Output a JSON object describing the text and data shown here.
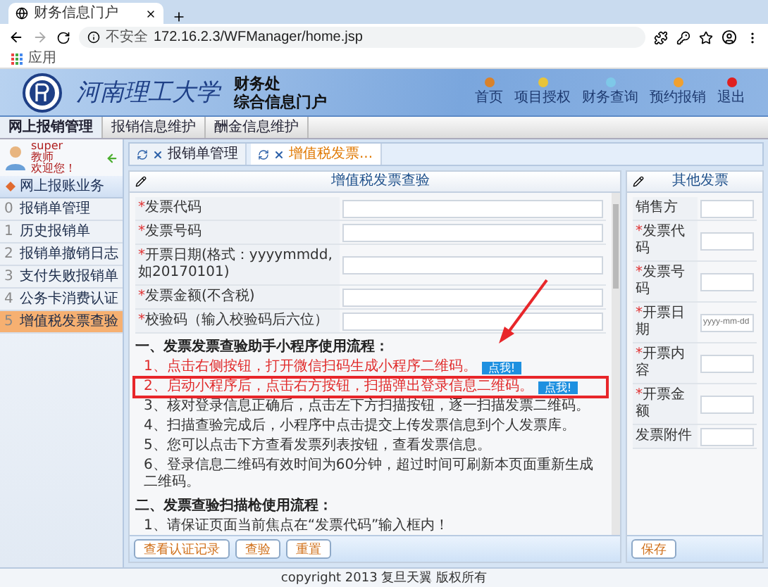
{
  "browser": {
    "tab_title": "财务信息门户",
    "security": "不安全",
    "url": "172.16.2.3/WFManager/home.jsp",
    "bookmarks": [
      "应用"
    ]
  },
  "header": {
    "school": "河南理工大学",
    "dept": "财务处",
    "portal": "综合信息门户",
    "links": [
      {
        "label": "首页",
        "color": "#d9822b"
      },
      {
        "label": "项目授权",
        "color": "#e8c43a"
      },
      {
        "label": "财务查询",
        "color": "#7ec8e8"
      },
      {
        "label": "预约报销",
        "color": "#f0a030"
      },
      {
        "label": "退出",
        "color": "#e02020"
      }
    ]
  },
  "menu": [
    {
      "label": "网上报销管理",
      "selected": true
    },
    {
      "label": "报销信息维护",
      "selected": false
    },
    {
      "label": "酬金信息维护",
      "selected": false
    }
  ],
  "user": {
    "name": "super",
    "role": "教师",
    "greeting": "欢迎您！"
  },
  "sidebar": {
    "section": "网上报账业务",
    "items": [
      {
        "index": "0",
        "label": "报销单管理",
        "selected": false
      },
      {
        "index": "1",
        "label": "历史报销单",
        "selected": false
      },
      {
        "index": "2",
        "label": "报销单撤销日志",
        "selected": false
      },
      {
        "index": "3",
        "label": "支付失败报销单",
        "selected": false
      },
      {
        "index": "4",
        "label": "公务卡消费认证",
        "selected": false
      },
      {
        "index": "5",
        "label": "增值税发票查验",
        "selected": true
      }
    ]
  },
  "tabs": [
    {
      "label": "报销单管理",
      "selected": false
    },
    {
      "label": "增值税发票...",
      "selected": true
    }
  ],
  "vat_panel": {
    "title": "增值税发票查验",
    "fields": [
      {
        "mark": "*",
        "label": "发票代码"
      },
      {
        "mark": "*",
        "label": "发票号码"
      },
      {
        "mark": "*",
        "label": "开票日期(格式：yyyymmdd,如20170101)"
      },
      {
        "mark": "*",
        "label": "发票金额(不含税)"
      },
      {
        "mark": "*",
        "label": "校验码（输入校验码后六位）"
      }
    ],
    "sections": [
      {
        "heading": "一、发票发票查验助手小程序使用流程：",
        "steps": [
          {
            "text": "1、点击右侧按钮，打开微信扫码生成小程序二维码。",
            "emphasis": true,
            "highlighted": false,
            "button": "点我!"
          },
          {
            "text": "2、启动小程序后，点击右方按钮，扫描弹出登录信息二维码。",
            "emphasis": true,
            "highlighted": true,
            "button": "点我!"
          },
          {
            "text": "3、核对登录信息正确后，点击左下方扫描按钮，逐一扫描发票二维码。",
            "emphasis": false,
            "highlighted": false
          },
          {
            "text": "4、扫描查验完成后，小程序中点击提交上传发票信息到个人发票库。",
            "emphasis": false,
            "highlighted": false
          },
          {
            "text": "5、您可以点击下方查看发票列表按钮，查看发票信息。",
            "emphasis": false,
            "highlighted": false
          },
          {
            "text": "6、登录信息二维码有效时间为60分钟，超过时间可刷新本页面重新生成二维码。",
            "emphasis": false,
            "highlighted": false
          }
        ]
      },
      {
        "heading": "二、发票查验扫描枪使用流程：",
        "steps": [
          {
            "text": "1、请保证页面当前焦点在“发票代码”输入框内！",
            "emphasis": false,
            "highlighted": false
          }
        ]
      }
    ],
    "buttons": [
      "查看认证记录",
      "查验",
      "重置"
    ]
  },
  "other_panel": {
    "title": "其他发票",
    "fields": [
      {
        "label": "销售方"
      },
      {
        "mark": "*",
        "label": "发票代码"
      },
      {
        "mark": "*",
        "label": "发票号码"
      },
      {
        "mark": "*",
        "label": "开票日期",
        "placeholder": "yyyy-mm-dd"
      },
      {
        "mark": "*",
        "label": "开票内容"
      },
      {
        "mark": "*",
        "label": "开票金额"
      },
      {
        "label": "发票附件"
      }
    ],
    "buttons": [
      "保存"
    ]
  },
  "footer": "copyright 2013 复旦天翼 版权所有"
}
